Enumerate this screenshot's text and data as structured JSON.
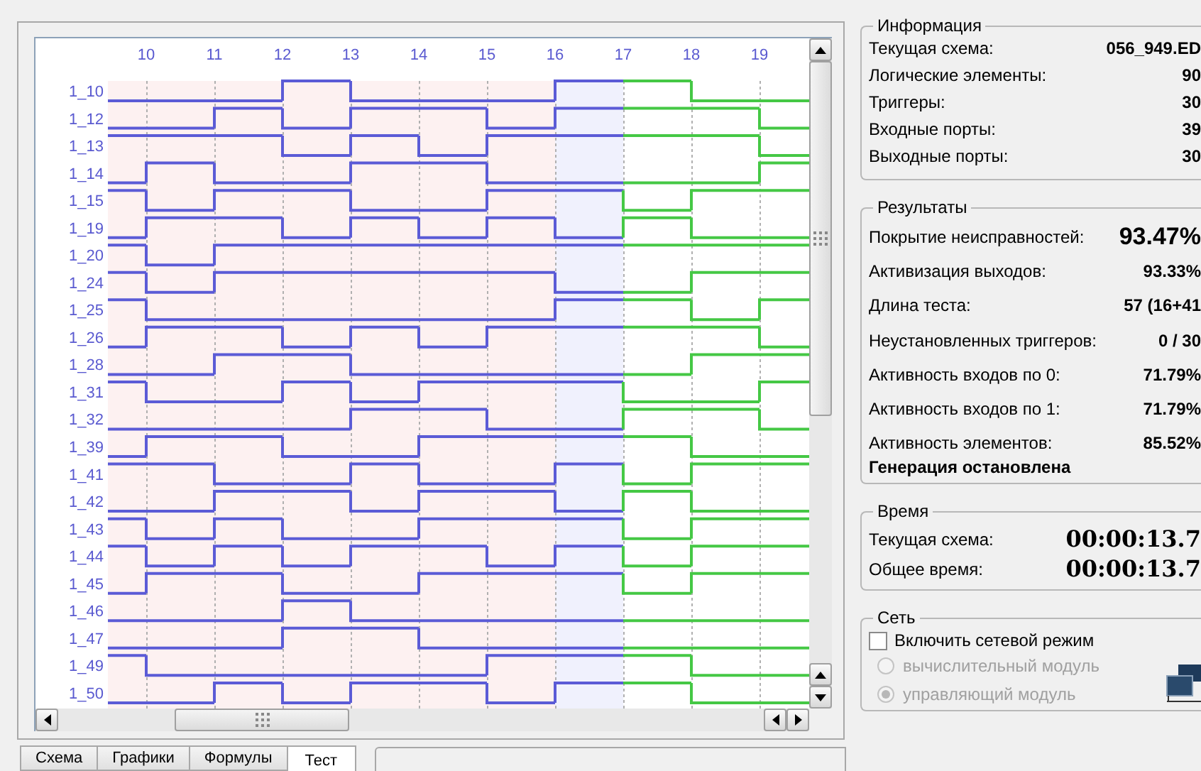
{
  "chart": {
    "columns": [
      "10",
      "11",
      "12",
      "13",
      "14",
      "15",
      "16",
      "17",
      "18",
      "19"
    ],
    "signals": [
      "1_10",
      "1_12",
      "1_13",
      "1_14",
      "1_15",
      "1_19",
      "1_20",
      "1_24",
      "1_25",
      "1_26",
      "1_28",
      "1_31",
      "1_32",
      "1_39",
      "1_41",
      "1_42",
      "1_43",
      "1_44",
      "1_45",
      "1_46",
      "1_47",
      "1_49",
      "1_50"
    ]
  },
  "tabs": [
    {
      "label": "Схема",
      "selected": false
    },
    {
      "label": "Графики",
      "selected": false
    },
    {
      "label": "Формулы",
      "selected": false
    },
    {
      "label": "Тест",
      "selected": true
    }
  ],
  "info": {
    "title": "Информация",
    "rows": [
      {
        "label": "Текущая схема:",
        "value": "056_949.ED"
      },
      {
        "label": "Логические элементы:",
        "value": "90"
      },
      {
        "label": "Триггеры:",
        "value": "30"
      },
      {
        "label": "Входные порты:",
        "value": "39"
      },
      {
        "label": "Выходные порты:",
        "value": "30"
      }
    ]
  },
  "results": {
    "title": "Результаты",
    "rows": [
      {
        "label": "Покрытие неисправностей:",
        "value": "93.47%",
        "kind": "large"
      },
      {
        "label": "Активизация выходов:",
        "value": "93.33%",
        "kind": "normal"
      },
      {
        "label": "Длина теста:",
        "value": "57 (16+41",
        "kind": "normal"
      },
      {
        "label": "Неустановленных триггеров:",
        "value": "0 / 30",
        "kind": "normal"
      },
      {
        "label": "Активность входов по 0:",
        "value": "71.79%",
        "kind": "normal"
      },
      {
        "label": "Активность входов по 1:",
        "value": "71.79%",
        "kind": "normal"
      },
      {
        "label": "Активность элементов:",
        "value": "85.52%",
        "kind": "normal"
      }
    ],
    "status": "Генерация остановлена"
  },
  "time": {
    "title": "Время",
    "rows": [
      {
        "label": "Текущая схема:",
        "value": "00:00:13.7"
      },
      {
        "label": "Общее время:",
        "value": "00:00:13.7"
      }
    ]
  },
  "network": {
    "title": "Сеть",
    "checkbox": {
      "label": "Включить сетевой режим",
      "checked": false
    },
    "options": [
      {
        "label": "вычислительный модуль",
        "selected": false,
        "disabled": true
      },
      {
        "label": "управляющий модуль",
        "selected": true,
        "disabled": true
      }
    ]
  }
}
